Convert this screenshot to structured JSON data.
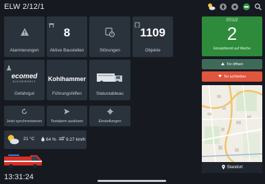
{
  "app": {
    "title": "ELW 2/12/1"
  },
  "tiles": [
    {
      "label": "Alarmierungen"
    },
    {
      "label": "Aktive Baustellen",
      "count": "8"
    },
    {
      "label": "Störungen"
    },
    {
      "label": "Objekte",
      "count": "1109"
    },
    {
      "label": "Gefahrgut",
      "logo": "ecomed",
      "logo_sub": "SICHERHEIT"
    },
    {
      "label": "Führungshilfen",
      "logo": "Kohlhammer"
    },
    {
      "label": "Statustableau"
    }
  ],
  "actions": [
    {
      "label": "Jetzt synchronisieren",
      "icon": "sync-icon"
    },
    {
      "label": "Testalarm auslösen",
      "icon": "send-icon"
    },
    {
      "label": "Einstellungen",
      "icon": "gear-icon"
    }
  ],
  "weather": {
    "temperature": "21 °C",
    "humidity": "64 %",
    "wind": "9.27 km/h"
  },
  "alarm": {
    "date": "07/1/2",
    "count": "2",
    "label": "Einsatzbereit auf Wache"
  },
  "gate": {
    "open_label": "Tor öffnen",
    "close_label": "Tor schließen"
  },
  "map": {
    "location_label": "Standort"
  },
  "clock": {
    "time": "13:31:24"
  },
  "colors": {
    "background": "#161a20",
    "tile": "#2a323c",
    "alarm_green": "#2e8b3b",
    "open_button": "#3f6a5a",
    "close_button": "#e0553e"
  }
}
